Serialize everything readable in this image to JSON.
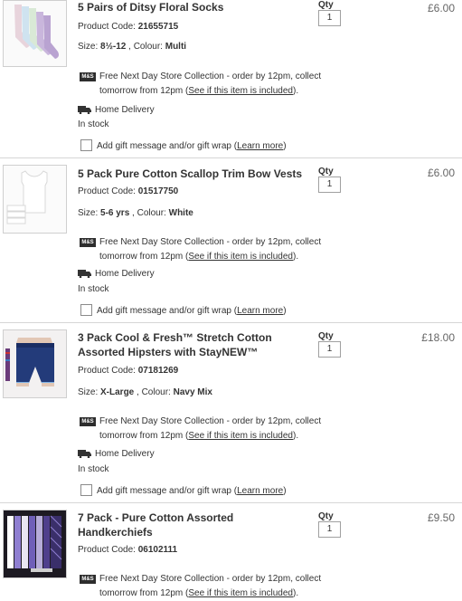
{
  "items": [
    {
      "title_line1": "5 Pairs of Ditsy Floral Socks",
      "title_line2": "",
      "product_code_label": "Product Code:",
      "product_code": "21655715",
      "size_label": "Size:",
      "size": "8½-12",
      "colour_label": ", Colour:",
      "colour": "Multi",
      "qty_label": "Qty",
      "qty": "1",
      "price": "£6.00",
      "collect_text_1": "Free Next Day Store Collection - order by 12pm, collect",
      "collect_text_2": "tomorrow from 12pm (",
      "collect_link": "See if this item is included",
      "collect_close": ").",
      "delivery": "Home Delivery",
      "stock": "In stock",
      "gift_text": "Add gift message and/or gift wrap (",
      "gift_link": "Learn more",
      "gift_close": ")"
    },
    {
      "title_line1": "5 Pack Pure Cotton Scallop Trim Bow Vests",
      "title_line2": "",
      "product_code_label": "Product Code:",
      "product_code": "01517750",
      "size_label": "Size:",
      "size": "5-6 yrs",
      "colour_label": ", Colour:",
      "colour": "White",
      "qty_label": "Qty",
      "qty": "1",
      "price": "£6.00",
      "collect_text_1": "Free Next Day Store Collection - order by 12pm, collect",
      "collect_text_2": "tomorrow from 12pm (",
      "collect_link": "See if this item is included",
      "collect_close": ").",
      "delivery": "Home Delivery",
      "stock": "In stock",
      "gift_text": "Add gift message and/or gift wrap (",
      "gift_link": "Learn more",
      "gift_close": ")"
    },
    {
      "title_line1": "3 Pack Cool & Fresh™ Stretch Cotton",
      "title_line2": "Assorted Hipsters with StayNEW™",
      "product_code_label": "Product Code:",
      "product_code": "07181269",
      "size_label": "Size:",
      "size": "X-Large",
      "colour_label": ", Colour:",
      "colour": "Navy Mix",
      "qty_label": "Qty",
      "qty": "1",
      "price": "£18.00",
      "collect_text_1": "Free Next Day Store Collection - order by 12pm, collect",
      "collect_text_2": "tomorrow from 12pm (",
      "collect_link": "See if this item is included",
      "collect_close": ").",
      "delivery": "Home Delivery",
      "stock": "In stock",
      "gift_text": "Add gift message and/or gift wrap (",
      "gift_link": "Learn more",
      "gift_close": ")"
    },
    {
      "title_line1": "7 Pack - Pure Cotton Assorted",
      "title_line2": "Handkerchiefs",
      "product_code_label": "Product Code:",
      "product_code": "06102111",
      "qty_label": "Qty",
      "qty": "1",
      "price": "£9.50",
      "collect_text_1": "Free Next Day Store Collection - order by 12pm, collect",
      "collect_text_2": "tomorrow from 12pm (",
      "collect_link": "See if this item is included",
      "collect_close": ")."
    }
  ],
  "store_logo_text": "M&S",
  "icons": {
    "store": "store-collection-icon",
    "delivery": "delivery-truck-icon"
  }
}
